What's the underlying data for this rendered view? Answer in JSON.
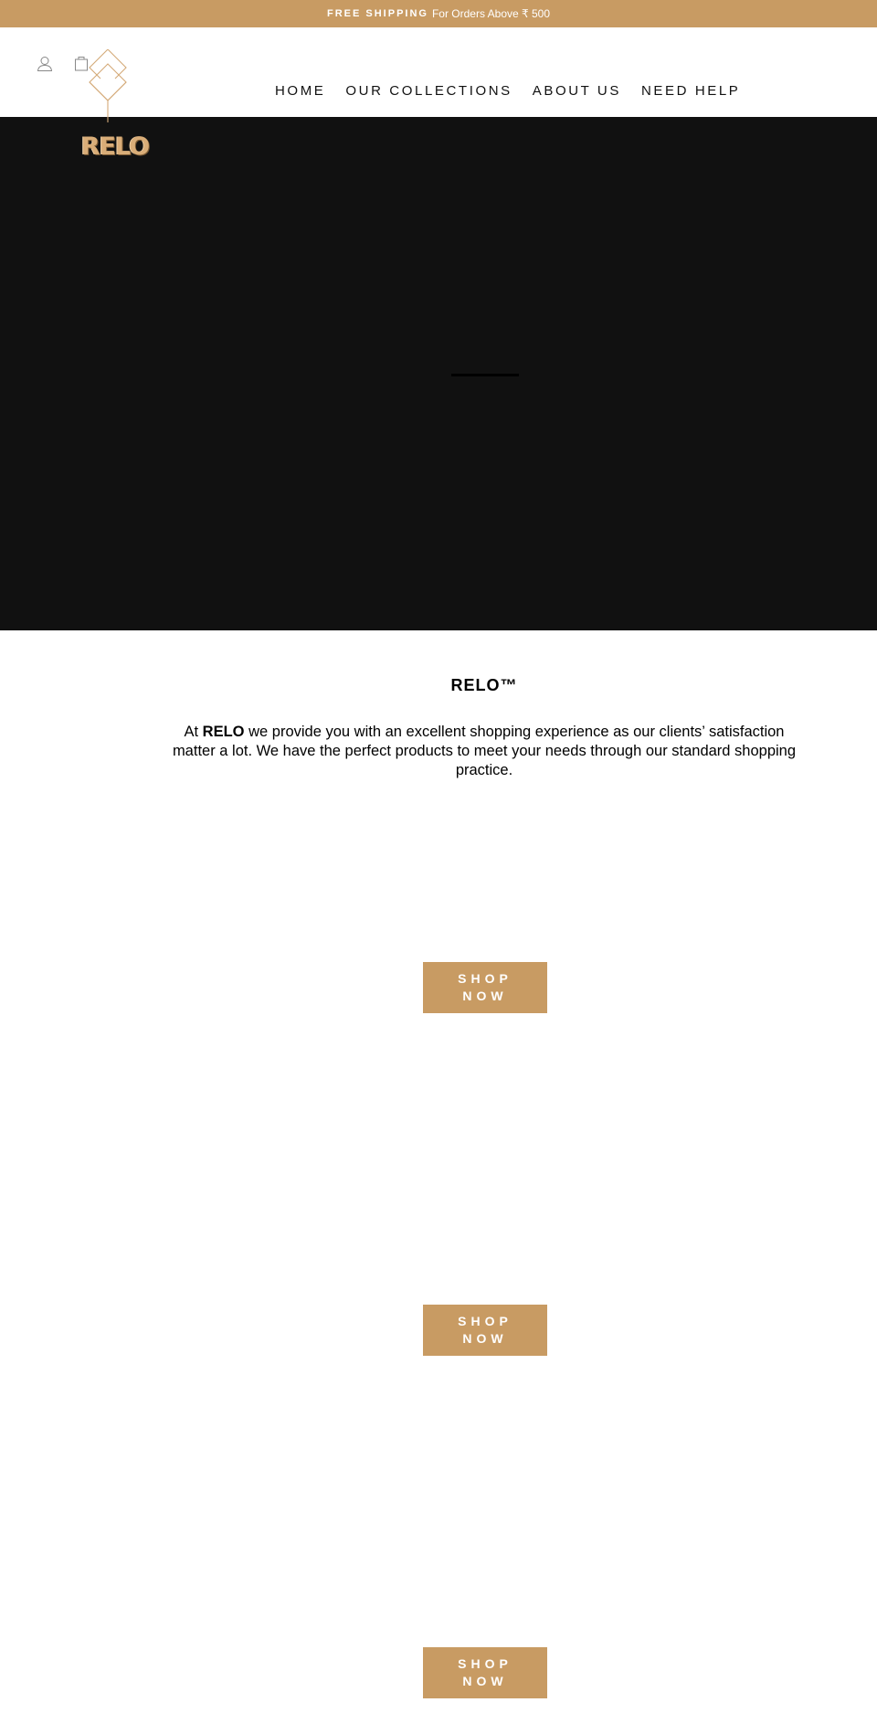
{
  "announcement": {
    "strong": "FREE SHIPPING",
    "rest": "For Orders Above ₹ 500"
  },
  "header": {
    "account_icon": "user-icon",
    "cart_icon": "shopping-bag-icon",
    "logo_text": "RELO",
    "nav": [
      {
        "label": "HOME"
      },
      {
        "label": "OUR COLLECTIONS"
      },
      {
        "label": "ABOUT US"
      },
      {
        "label": "NEED HELP"
      }
    ]
  },
  "hero": {
    "state": "loading"
  },
  "intro": {
    "title": "RELO™",
    "brand": "RELO",
    "text_before": "At ",
    "text_after": " we provide you with an excellent shopping experience as our clients’ satisfaction matter a lot. We have the perfect products to meet your needs through our standard shopping practice."
  },
  "collections": [
    {
      "button_label": "SHOP NOW"
    },
    {
      "button_label": "SHOP NOW"
    },
    {
      "button_label": "SHOP NOW"
    }
  ],
  "colors": {
    "accent": "#c89b63",
    "hero_bg": "#111111",
    "text": "#111111"
  }
}
